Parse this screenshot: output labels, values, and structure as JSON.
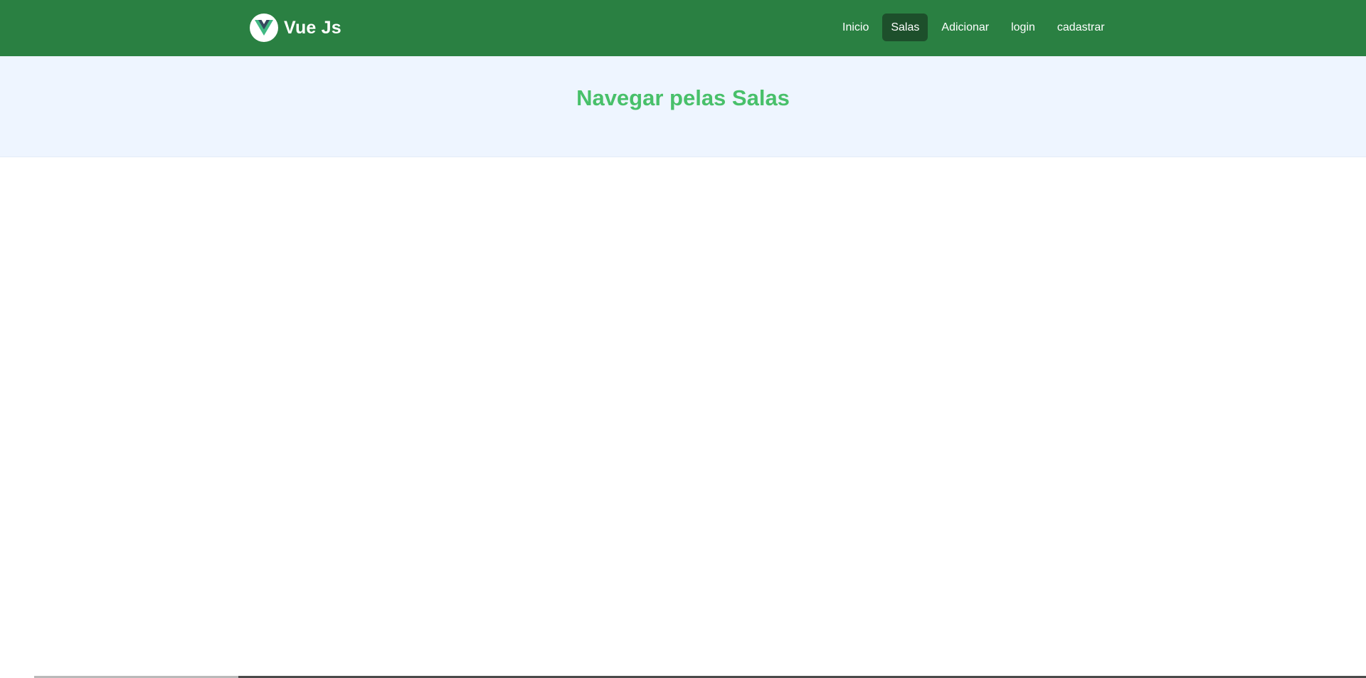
{
  "header": {
    "brand": {
      "text": "Vue Js",
      "icon": "vue-logo-icon"
    },
    "nav": [
      {
        "label": "Inicio",
        "active": false
      },
      {
        "label": "Salas",
        "active": true
      },
      {
        "label": "Adicionar",
        "active": false
      },
      {
        "label": "login",
        "active": false
      },
      {
        "label": "cadastrar",
        "active": false
      }
    ]
  },
  "hero": {
    "title": "Navegar pelas Salas"
  },
  "colors": {
    "navbar_bg": "#2a8042",
    "nav_active_bg": "#1d4f2b",
    "hero_bg": "#eef5ff",
    "title_color": "#48c06a",
    "vue_green": "#41b883",
    "vue_dark": "#35495e"
  }
}
